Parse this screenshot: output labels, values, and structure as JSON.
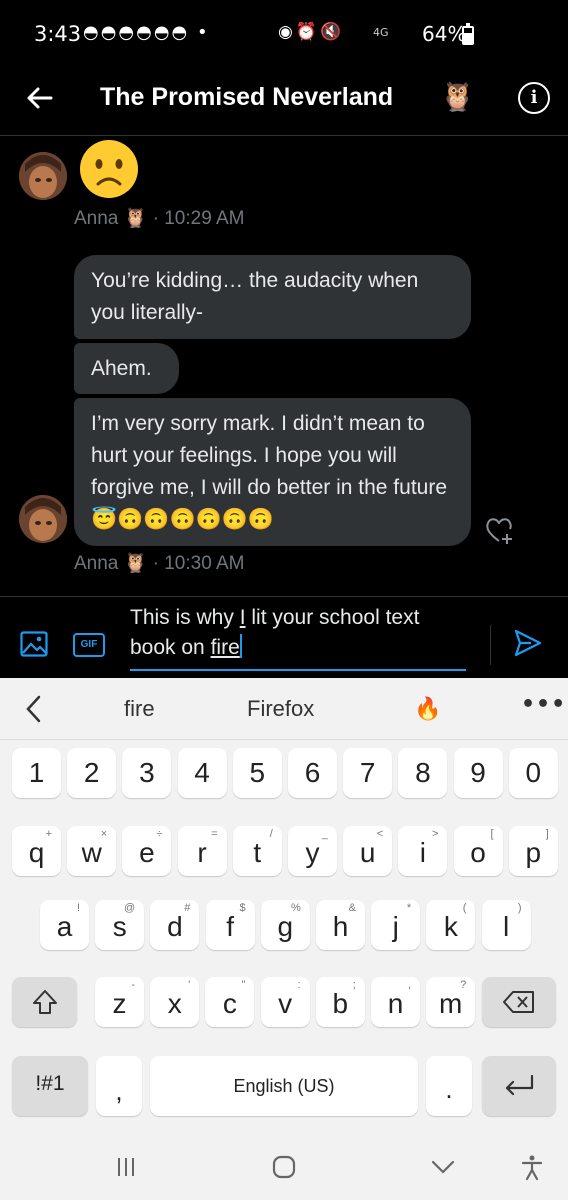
{
  "status_bar": {
    "time": "3:43",
    "notification_icons": "◓◓◓◓◓◓ •",
    "system_icons": "◉⏰🔇",
    "network": "4G",
    "battery": "64%"
  },
  "header": {
    "title": "The Promised Neverland",
    "title_emoji": "🦉"
  },
  "messages": {
    "first_sender": "Anna",
    "first_sender_emoji": "🦉",
    "first_time": "· 10:29 AM",
    "bubble_1": "You’re kidding… the audacity when you literally-",
    "bubble_2": "Ahem.",
    "bubble_3": "I’m very sorry mark. I didn’t mean to hurt your feelings. I hope you will forgive me, I will do better in the future 😇🙃🙃🙃🙃🙃🙃",
    "second_sender": "Anna",
    "second_sender_emoji": "🦉",
    "second_time": "· 10:30 AM"
  },
  "composer": {
    "text_before": "This is why ",
    "text_underlined_1": "I",
    "text_middle": " lit your school text book on ",
    "text_underlined_2": "fire",
    "gif_label": "GIF"
  },
  "keyboard": {
    "suggestions": [
      "fire",
      "Firefox",
      "🔥"
    ],
    "more_label": "•••",
    "number_row": [
      "1",
      "2",
      "3",
      "4",
      "5",
      "6",
      "7",
      "8",
      "9",
      "0"
    ],
    "row1": [
      "q",
      "w",
      "e",
      "r",
      "t",
      "y",
      "u",
      "i",
      "o",
      "p"
    ],
    "row1_sup": [
      "+",
      "×",
      "÷",
      "=",
      "/",
      "_",
      "<",
      ">",
      "[",
      "]"
    ],
    "row2": [
      "a",
      "s",
      "d",
      "f",
      "g",
      "h",
      "j",
      "k",
      "l"
    ],
    "row2_sup": [
      "!",
      "@",
      "#",
      "$",
      "%",
      "&",
      "*",
      "(",
      ")"
    ],
    "row3": [
      "z",
      "x",
      "c",
      "v",
      "b",
      "n",
      "m"
    ],
    "row3_sup": [
      "-",
      "'",
      "\"",
      ":",
      ";",
      ",",
      "?"
    ],
    "symbols_label": "!#1",
    "comma_label": ",",
    "space_label": "English (US)",
    "period_label": "."
  },
  "colors": {
    "accent": "#1d9bf0",
    "bubble": "#2f3336",
    "muted": "#71767b"
  }
}
